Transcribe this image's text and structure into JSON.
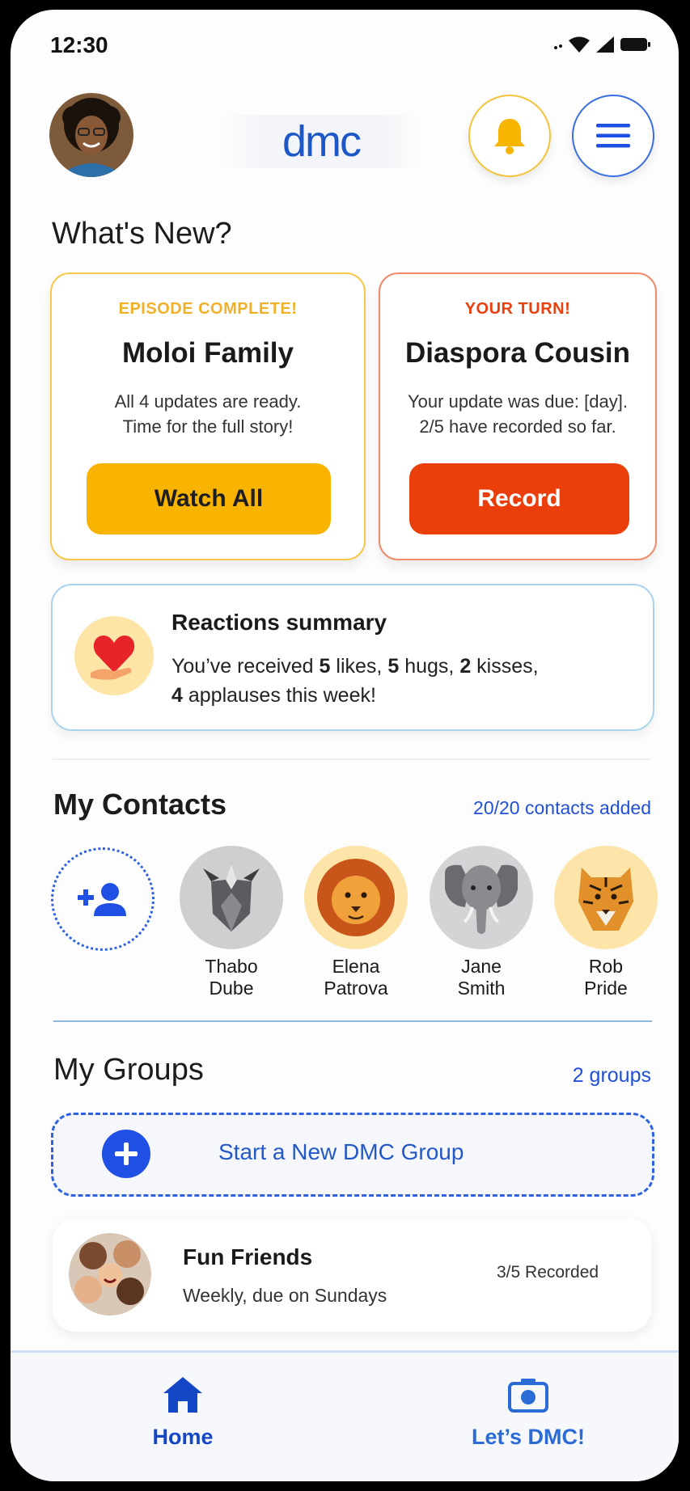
{
  "status_bar": {
    "time": "12:30"
  },
  "header": {
    "logo_text": "dmc",
    "avatar_icon": "user-avatar",
    "bell_icon": "bell-icon",
    "menu_icon": "hamburger-menu-icon"
  },
  "whats_new": {
    "title": "What's New?",
    "cards": [
      {
        "eyebrow": "EPISODE COMPLETE!",
        "eyebrow_color": "#f0b12a",
        "title": "Moloi Family",
        "line1": "All 4 updates are ready.",
        "line2": "Time for the full story!",
        "button": "Watch All",
        "button_color": "#f8b400"
      },
      {
        "eyebrow": "YOUR TURN!",
        "eyebrow_color": "#e8400f",
        "title": "Diaspora Cousin",
        "line1": "Your update was due: [day].",
        "line2": "2/5 have recorded so far.",
        "button": "Record",
        "button_color": "#ea3f0b"
      }
    ]
  },
  "reactions": {
    "icon": "heart-hand-icon",
    "title": "Reactions summary",
    "prefix": "You’ve received",
    "likes": "5",
    "likes_label": "likes,",
    "hugs": "5",
    "hugs_label": "hugs,",
    "kisses": "2",
    "kisses_label": "kisses,",
    "applauses": "4",
    "applauses_label": "applauses this week!"
  },
  "contacts": {
    "title": "My Contacts",
    "count": "20/20 contacts added",
    "add_icon": "add-person-icon",
    "items": [
      {
        "first": "Thabo",
        "last": "Dube",
        "icon": "rhino-avatar"
      },
      {
        "first": "Elena",
        "last": "Patrova",
        "icon": "lion-avatar"
      },
      {
        "first": "Jane",
        "last": "Smith",
        "icon": "elephant-avatar"
      },
      {
        "first": "Rob",
        "last": "Pride",
        "icon": "tiger-avatar"
      }
    ]
  },
  "groups": {
    "title": "My Groups",
    "count": "2 groups",
    "new_group_label": "Start a New DMC Group",
    "items": [
      {
        "name": "Fun Friends",
        "schedule": "Weekly, due on Sundays",
        "status": "3/5 Recorded"
      }
    ]
  },
  "bottom_nav": {
    "home": "Home",
    "dmc": "Let’s DMC!",
    "home_icon": "home-icon",
    "camera_icon": "camera-icon"
  },
  "colors": {
    "primary_blue": "#1f4fe3",
    "accent_yellow": "#f8b400",
    "accent_red": "#ea3f0b"
  }
}
